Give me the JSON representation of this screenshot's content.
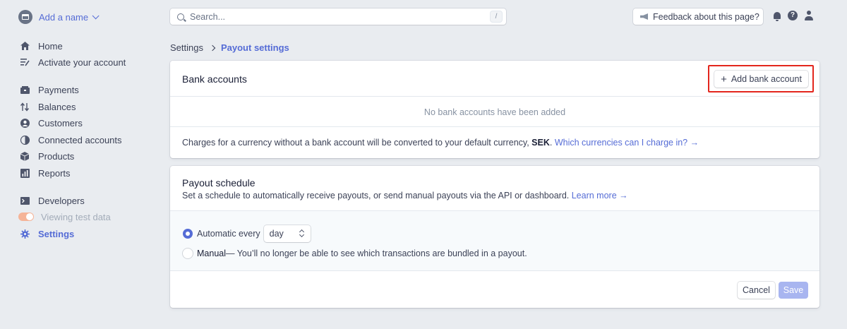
{
  "sidebar": {
    "account_name": "Add a name",
    "items": [
      {
        "label": "Home",
        "icon": "home-icon"
      },
      {
        "label": "Activate your account",
        "icon": "checklist-icon"
      },
      {
        "label": "Payments",
        "icon": "wallet-icon"
      },
      {
        "label": "Balances",
        "icon": "arrows-icon"
      },
      {
        "label": "Customers",
        "icon": "person-icon"
      },
      {
        "label": "Connected accounts",
        "icon": "globe-icon"
      },
      {
        "label": "Products",
        "icon": "box-icon"
      },
      {
        "label": "Reports",
        "icon": "chart-icon"
      },
      {
        "label": "Developers",
        "icon": "terminal-icon"
      },
      {
        "label": "Viewing test data",
        "icon": "toggle-icon"
      },
      {
        "label": "Settings",
        "icon": "gear-icon"
      }
    ]
  },
  "topbar": {
    "search_placeholder": "Search...",
    "search_shortcut": "/",
    "feedback_label": "Feedback about this page?",
    "help_glyph": "?"
  },
  "breadcrumb": {
    "parent": "Settings",
    "current": "Payout settings"
  },
  "bank_accounts": {
    "title": "Bank accounts",
    "add_button": "Add bank account",
    "add_button_glyph": "+",
    "empty_text": "No bank accounts have been added",
    "note_prefix": "Charges for a currency without a bank account will be converted to your default currency, ",
    "note_currency": "SEK",
    "note_suffix": ".",
    "note_link": "Which currencies can I charge in? →"
  },
  "payout_schedule": {
    "title": "Payout schedule",
    "description": "Set a schedule to automatically receive payouts, or send manual payouts via the API or dashboard.",
    "learn_more": "Learn more →",
    "automatic_label": "Automatic every",
    "interval_value": "day",
    "manual_label": "Manual",
    "manual_desc": " — You’ll no longer be able to see which transactions are bundled in a payout.",
    "cancel_button": "Cancel",
    "save_button": "Save"
  },
  "colors": {
    "accent": "#556cd6",
    "highlight_box": "#e3261d",
    "save_disabled": "#a8b5f0"
  }
}
